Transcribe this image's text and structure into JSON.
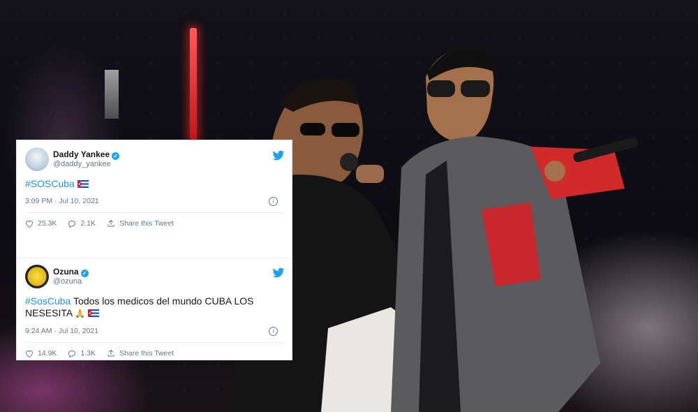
{
  "tweets": [
    {
      "display_name": "Daddy Yankee",
      "handle": "@daddy_yankee",
      "hashtag": "#SOSCuba",
      "text": "",
      "emoji": [
        "cuba-flag"
      ],
      "timestamp": "3:09 PM · Jul 10, 2021",
      "likes": "25.3K",
      "replies": "2.1K",
      "share_label": "Share this Tweet"
    },
    {
      "display_name": "Ozuna",
      "handle": "@ozuna",
      "hashtag": "#SosCuba",
      "text": " Todos los medicos del mundo CUBA LOS NESESITA",
      "emoji": [
        "praying-hands",
        "cuba-flag"
      ],
      "timestamp": "9:24 AM · Jul 10, 2021",
      "likes": "14.9K",
      "replies": "1.3K",
      "share_label": "Share this Tweet"
    }
  ],
  "colors": {
    "twitter_blue": "#1da1f2",
    "hashtag_blue": "#1b95e0",
    "meta_gray": "#657786"
  }
}
